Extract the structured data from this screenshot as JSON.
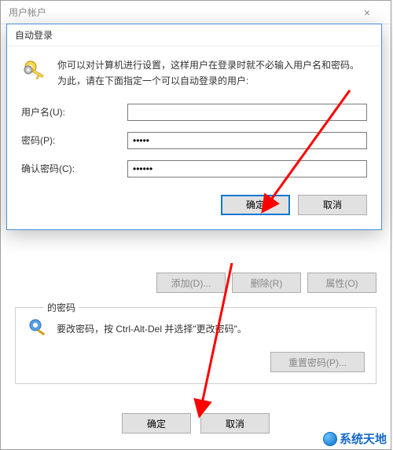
{
  "parent_window": {
    "title": "用户帐户",
    "close_glyph": "×",
    "buttons": {
      "add": "添加(D)...",
      "remove": "删除(R)",
      "properties": "属性(O)"
    },
    "groupbox": {
      "legend": "的密码",
      "text": "要改密码，按 Ctrl-Alt-Del 并选择\"更改密码\"。",
      "reset_button": "重置密码(P)..."
    },
    "bottom_ok": "确定",
    "bottom_cancel": "取消"
  },
  "dialog": {
    "title": "自动登录",
    "description": "你可以对计算机进行设置，这样用户在登录时就不必输入用户名和密码。为此，请在下面指定一个可以自动登录的用户:",
    "username_label": "用户名(U):",
    "username_value": "",
    "password_label": "密码(P):",
    "password_value": "•••••",
    "confirm_label": "确认密码(C):",
    "confirm_value": "••••••",
    "ok": "确定",
    "cancel": "取消"
  },
  "watermark": "系统天地",
  "colors": {
    "accent": "#0078d7",
    "arrow": "#ff0000"
  }
}
